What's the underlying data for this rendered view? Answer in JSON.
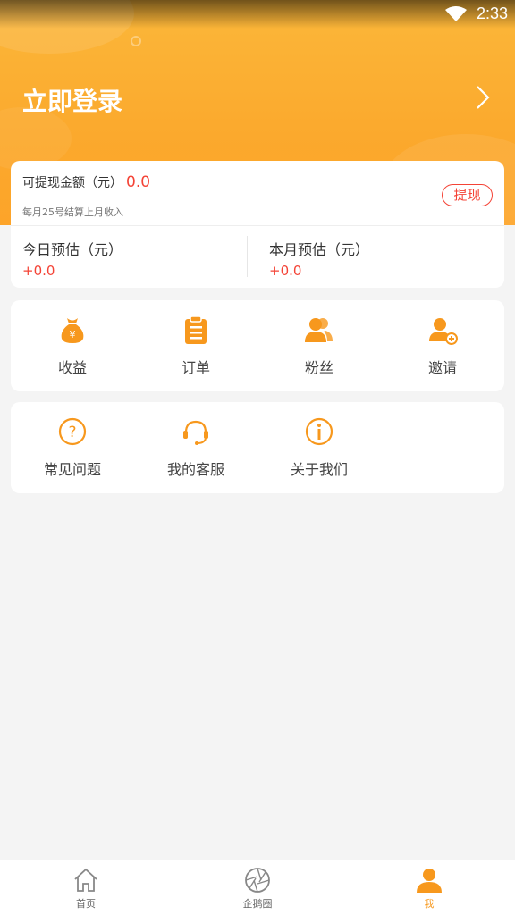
{
  "status_bar": {
    "time": "2:33"
  },
  "header": {
    "login_label": "立即登录"
  },
  "balance": {
    "withdrawable_label": "可提现金额（元）",
    "withdrawable_value": "0.0",
    "settle_note": "每月25号结算上月收入",
    "withdraw_button": "提现",
    "today_label": "今日预估（元）",
    "today_value": "+0.0",
    "month_label": "本月预估（元）",
    "month_value": "+0.0"
  },
  "menu_primary": [
    {
      "label": "收益",
      "icon": "money-bag-icon"
    },
    {
      "label": "订单",
      "icon": "clipboard-icon"
    },
    {
      "label": "粉丝",
      "icon": "users-icon"
    },
    {
      "label": "邀请",
      "icon": "add-user-icon"
    }
  ],
  "menu_secondary": [
    {
      "label": "常见问题",
      "icon": "question-icon"
    },
    {
      "label": "我的客服",
      "icon": "headset-icon"
    },
    {
      "label": "关于我们",
      "icon": "info-icon"
    }
  ],
  "bottom_nav": [
    {
      "label": "首页",
      "icon": "home-icon"
    },
    {
      "label": "企鹅圈",
      "icon": "shutter-icon"
    },
    {
      "label": "我",
      "icon": "profile-icon",
      "active": true
    }
  ],
  "colors": {
    "accent_orange": "#f7981d",
    "header_orange": "#fba92d",
    "value_red": "#f44336",
    "background": "#f4f4f4"
  }
}
